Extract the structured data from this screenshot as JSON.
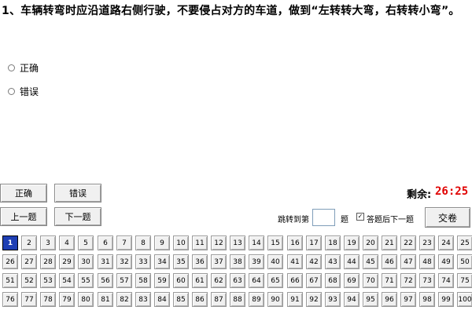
{
  "question": {
    "text": "1、车辆转弯时应沿道路右侧行驶，不要侵占对方的车道，做到“左转转大弯，右转转小弯”。"
  },
  "options": [
    {
      "label": "正确"
    },
    {
      "label": "错误"
    }
  ],
  "buttons": {
    "correct_label": "正确",
    "wrong_label": "错误",
    "prev_label": "上一题",
    "next_label": "下一题",
    "submit_label": "交卷"
  },
  "timer": {
    "label": "剩余:",
    "value": "26:25"
  },
  "jump": {
    "label": "跳转到第",
    "value": "",
    "suffix": "题"
  },
  "auto_next": {
    "checked": true,
    "label": "答题后下一题"
  },
  "question_numbers": {
    "current": 1,
    "total": 100
  },
  "colors": {
    "current_bg": "#1e3fb4",
    "timer": "#e00000"
  }
}
